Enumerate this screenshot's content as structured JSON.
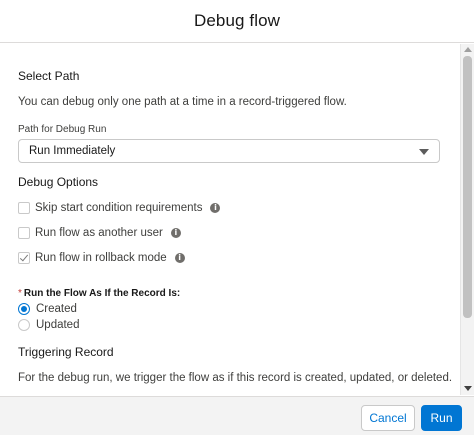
{
  "header": {
    "title": "Debug flow"
  },
  "select_path": {
    "heading": "Select Path",
    "description": "You can debug only one path at a time in a record-triggered flow.",
    "field_label": "Path for Debug Run",
    "selected_value": "Run Immediately"
  },
  "debug_options": {
    "heading": "Debug Options",
    "items": [
      {
        "label": "Skip start condition requirements",
        "checked": false,
        "icon": "info-icon"
      },
      {
        "label": "Run flow as another user",
        "checked": false,
        "icon": "info-icon"
      },
      {
        "label": "Run flow in rollback mode",
        "checked": true,
        "icon": "info-icon"
      }
    ]
  },
  "run_as": {
    "required_marker": "*",
    "label": "Run the Flow As If the Record Is:",
    "options": [
      {
        "label": "Created",
        "selected": true
      },
      {
        "label": "Updated",
        "selected": false
      }
    ]
  },
  "triggering_record": {
    "heading": "Triggering Record",
    "description": "For the debug run, we trigger the flow as if this record is created, updated, or deleted."
  },
  "footer": {
    "cancel_label": "Cancel",
    "run_label": "Run"
  },
  "colors": {
    "brand": "#0176d3",
    "required": "#c23934",
    "footer_bg": "#f3f3f3"
  }
}
